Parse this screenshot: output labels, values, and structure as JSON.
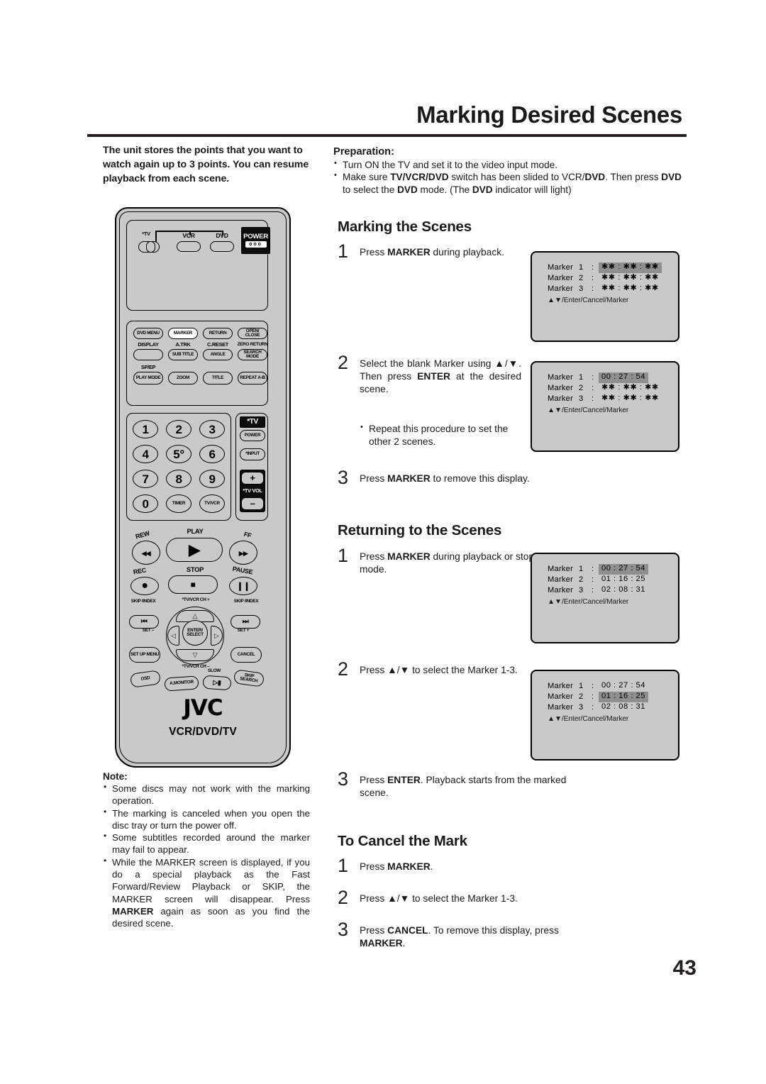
{
  "page": {
    "title": "Marking Desired Scenes",
    "number": "43"
  },
  "intro": "The unit stores the points that you want to watch again up to 3 points. You can resume playback from each scene.",
  "preparation": {
    "heading": "Preparation:",
    "items": [
      "Turn ON the TV and set it to the video input mode.",
      "Make sure TV/VCR/DVD switch has been slided to VCR/DVD. Then press DVD to select the DVD mode. (The DVD indicator will light)"
    ]
  },
  "sections": {
    "marking": {
      "heading": "Marking the Scenes",
      "step1_num": "1",
      "step1_text": "Press MARKER during playback.",
      "step2_num": "2",
      "step2_text": "Select the blank Marker using ▲/▼. Then press ENTER at the desired scene.",
      "step2_bullet": "Repeat this procedure to set the other 2 scenes.",
      "step3_num": "3",
      "step3_text": "Press MARKER to remove this display."
    },
    "returning": {
      "heading": "Returning to the Scenes",
      "step1_num": "1",
      "step1_text": "Press MARKER during playback or stop mode.",
      "step2_num": "2",
      "step2_text": "Press ▲/▼ to select the Marker 1-3.",
      "step3_num": "3",
      "step3_text": "Press ENTER. Playback starts from the marked scene."
    },
    "cancel": {
      "heading": "To Cancel the Mark",
      "step1_num": "1",
      "step1_text": "Press MARKER.",
      "step2_num": "2",
      "step2_text": "Press ▲/▼ to select the Marker 1-3.",
      "step3_num": "3",
      "step3_text": "Press CANCEL. To remove this display, press MARKER."
    }
  },
  "note": {
    "heading": "Note:",
    "items": [
      "Some discs may not work with the marking operation.",
      "The marking is canceled when you open the disc tray or turn the power off.",
      "Some subtitles recorded around the marker may fail to appear.",
      "While the MARKER screen is displayed, if you do a special playback as the Fast Forward/Review Playback or SKIP, the MARKER screen will disappear. Press MARKER again as soon as you find the desired scene."
    ]
  },
  "osd": {
    "marker_word": "Marker",
    "colon": ":",
    "hint": "▲▼/Enter/Cancel/Marker",
    "blank_value": "✱✱ : ✱✱ : ✱✱",
    "boxes": [
      {
        "id": "osd-marking-step1",
        "rows": [
          {
            "index": "1",
            "value": "✱✱ : ✱✱ : ✱✱",
            "highlight": true
          },
          {
            "index": "2",
            "value": "✱✱ : ✱✱ : ✱✱",
            "highlight": false
          },
          {
            "index": "3",
            "value": "✱✱ : ✱✱ : ✱✱",
            "highlight": false
          }
        ]
      },
      {
        "id": "osd-marking-step2",
        "rows": [
          {
            "index": "1",
            "value": "00 : 27 : 54",
            "highlight": true
          },
          {
            "index": "2",
            "value": "✱✱ : ✱✱ : ✱✱",
            "highlight": false
          },
          {
            "index": "3",
            "value": "✱✱ : ✱✱ : ✱✱",
            "highlight": false
          }
        ]
      },
      {
        "id": "osd-returning-step1",
        "rows": [
          {
            "index": "1",
            "value": "00 : 27 : 54",
            "highlight": true
          },
          {
            "index": "2",
            "value": "01 : 16 : 25",
            "highlight": false
          },
          {
            "index": "3",
            "value": "02 : 08 : 31",
            "highlight": false
          }
        ]
      },
      {
        "id": "osd-returning-step2",
        "rows": [
          {
            "index": "1",
            "value": "00 : 27 : 54",
            "highlight": false
          },
          {
            "index": "2",
            "value": "01 : 16 : 25",
            "highlight": true
          },
          {
            "index": "3",
            "value": "02 : 08 : 31",
            "highlight": false
          }
        ]
      }
    ]
  },
  "remote": {
    "brand": "JVC",
    "model": "VCR/DVD/TV",
    "mode_switch_tv": "*TV",
    "mode_vcr": "VCR",
    "mode_dvd": "DVD",
    "power": "POWER",
    "row1": [
      "DVD MENU",
      "MARKER",
      "RETURN",
      "OPEN/ CLOSE"
    ],
    "row2_top": [
      "DISPLAY",
      "A.TRK",
      "C.RESET",
      "ZERO RETURN"
    ],
    "row2": [
      "",
      "SUB TITLE",
      "ANGLE",
      "SEARCH MODE"
    ],
    "row3_top": [
      "SP/EP",
      "",
      "",
      ""
    ],
    "row3": [
      "PLAY MODE",
      "ZOOM",
      "TITLE",
      "REPEAT A-B"
    ],
    "digits": [
      "1",
      "2",
      "3",
      "4",
      "5°",
      "6",
      "7",
      "8",
      "9",
      "0",
      "TIMER",
      "TV/VCR"
    ],
    "tv_tag": "*TV",
    "tv_power": "POWER",
    "tv_input": "*INPUT",
    "tv_vol": "*TV VOL",
    "tv_vol_plus": "+",
    "tv_vol_minus": "–",
    "transport": {
      "rew": "REW",
      "play": "PLAY",
      "ff": "FF",
      "rec": "REC",
      "stop": "STOP",
      "pause": "PAUSE"
    },
    "skip_index_left": "SKIP /INDEX",
    "skip_index_right": "SKIP /INDEX",
    "ch_up": "*TV/VCR CH +",
    "ch_down": "*TV/VCR CH –",
    "enter_select": "ENTER/ SELECT",
    "set_minus": "SET –",
    "set_plus": "SET +",
    "setup_menu": "SET UP MENU",
    "cancel": "CANCEL",
    "osd_btn": "OSD",
    "a_monitor": "A.MONITOR",
    "slow": "SLOW",
    "skip_search": "SKIP SEARCH"
  }
}
